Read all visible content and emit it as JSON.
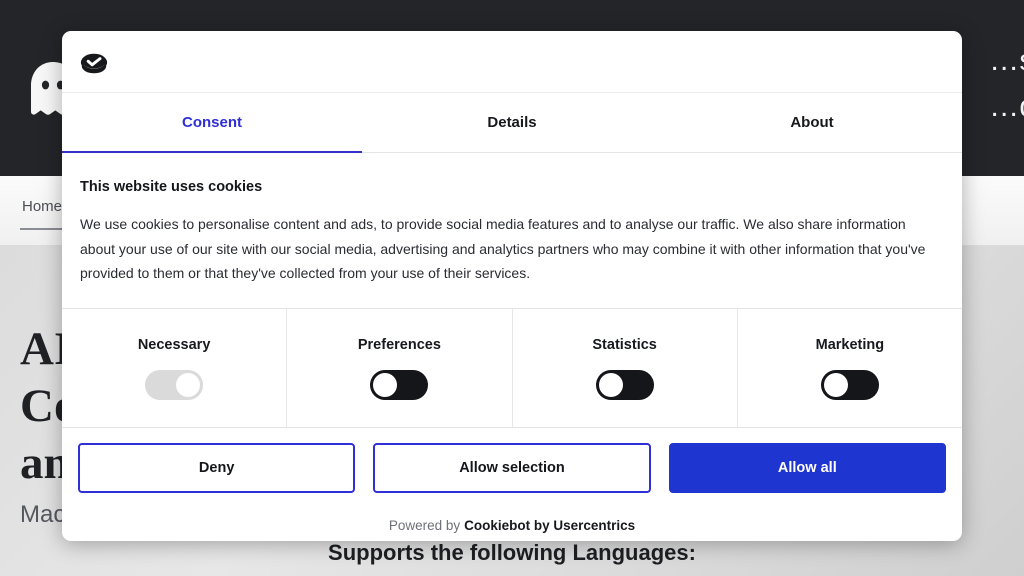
{
  "background": {
    "header": {
      "logo_icon": "ghost-logo-icon",
      "headline": "…se.\n…ds."
    },
    "nav": {
      "items": [
        {
          "label": "Home",
          "active": true
        }
      ]
    },
    "hero": {
      "title": "AI\nCo\nan",
      "subtitle": "Mac",
      "languages_heading": "Supports the following Languages:"
    }
  },
  "dialog": {
    "logo_icon": "cookiebot-cookie-check-icon",
    "tabs": [
      {
        "id": "consent",
        "label": "Consent",
        "active": true
      },
      {
        "id": "details",
        "label": "Details",
        "active": false
      },
      {
        "id": "about",
        "label": "About",
        "active": false
      }
    ],
    "consent": {
      "heading": "This website uses cookies",
      "paragraph": "We use cookies to personalise content and ads, to provide social media features and to analyse our traffic. We also share information about your use of our site with our social media, advertising and analytics partners who may combine it with other information that you've provided to them or that they've collected from your use of their services."
    },
    "categories": [
      {
        "id": "necessary",
        "label": "Necessary",
        "state": "on",
        "locked": true
      },
      {
        "id": "preferences",
        "label": "Preferences",
        "state": "off",
        "locked": false
      },
      {
        "id": "statistics",
        "label": "Statistics",
        "state": "off",
        "locked": false
      },
      {
        "id": "marketing",
        "label": "Marketing",
        "state": "off",
        "locked": false
      }
    ],
    "actions": {
      "deny": "Deny",
      "allow_selection": "Allow selection",
      "allow_all": "Allow all"
    },
    "footer": {
      "powered_by": "Powered by",
      "brand": "Cookiebot by Usercentrics"
    },
    "colors": {
      "accent_blue": "#1f35cf",
      "tab_active": "#2f2fd8",
      "toggle_on": "#151619",
      "toggle_locked": "#dadada"
    }
  }
}
